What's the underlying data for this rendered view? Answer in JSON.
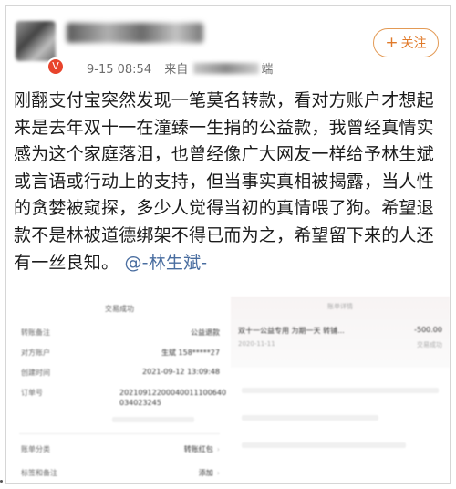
{
  "header": {
    "time": "9-15 08:54",
    "source_prefix": "来自",
    "source_suffix": "端",
    "follow_label": "关注",
    "follow_icon": "plus-icon",
    "verified_icon": "v-badge-icon"
  },
  "post": {
    "body": "刚翻支付宝突然发现一笔莫名转款，看对方账户才想起来是去年双十一在潼臻一生捐的公益款，我曾经真情实感为这个家庭落泪，也曾经像广大网友一样给予林生斌或言语或行动上的支持，但当事实真相被揭露，当人性的贪婪被窥探，多少人觉得当初的真情喂了狗。希望退款不是林被道德绑架不得已而为之，希望留下来的人还有一丝良知。",
    "mention": "@-林生斌-"
  },
  "left_shot": {
    "title": "交易成功",
    "rows": [
      {
        "label": "转账备注",
        "value": "公益退款"
      },
      {
        "label": "对方账户",
        "value": "生斌 158*****27"
      },
      {
        "label": "创建时间",
        "value": "2021-09-12 13:09:48"
      },
      {
        "label": "订单号",
        "value": "20210912200040011100640034023245"
      },
      {
        "label": "账单分类",
        "value": "转账红包"
      },
      {
        "label": "标签和备注",
        "value": "添加"
      }
    ]
  },
  "right_shot": {
    "header": "账单详情",
    "item": "双十一公益专用 为期一天 转铺...",
    "amount": "-500.00",
    "date": "2020-11-11",
    "status": "交易成功"
  },
  "colors": {
    "accent": "#e07a2a",
    "mention": "#4a6ea0",
    "verified": "#e8442c"
  }
}
